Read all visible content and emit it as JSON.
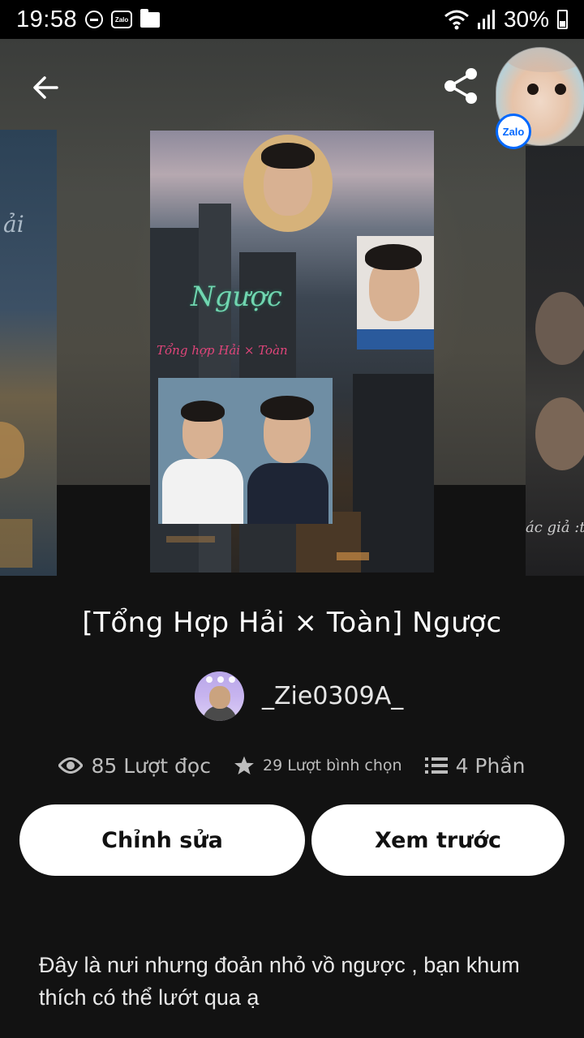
{
  "status_bar": {
    "time": "19:58",
    "zalo_label": "Zalo",
    "battery": "30%",
    "icons": [
      "do-not-disturb-icon",
      "zalo-notification-icon",
      "folder-icon",
      "wifi-icon",
      "signal-icon",
      "battery-icon"
    ]
  },
  "header": {
    "back_icon": "arrow-left-icon",
    "share_icon": "share-icon"
  },
  "cover": {
    "title_text": "Ngược",
    "subtitle_text": "Tổng hợp Hải × Toàn",
    "right_caption": "ác giả :t"
  },
  "chat_bubble": {
    "badge": "Zalo"
  },
  "story": {
    "title": "[Tổng Hợp Hải × Toàn] Ngược",
    "author": "_Zie0309A_",
    "stats": {
      "reads": "85 Lượt đọc",
      "votes": "29 Lượt bình chọn",
      "parts": "4 Phần"
    },
    "buttons": {
      "edit": "Chỉnh sửa",
      "preview": "Xem trước"
    },
    "description": "Đây là nưi nhưng đoản nhỏ vồ ngược , bạn khum thích có thể lướt qua ạ"
  },
  "colors": {
    "background": "#121212",
    "button_bg": "#ffffff",
    "zalo_blue": "#0068ff",
    "stat_text": "#bdbdbd"
  }
}
